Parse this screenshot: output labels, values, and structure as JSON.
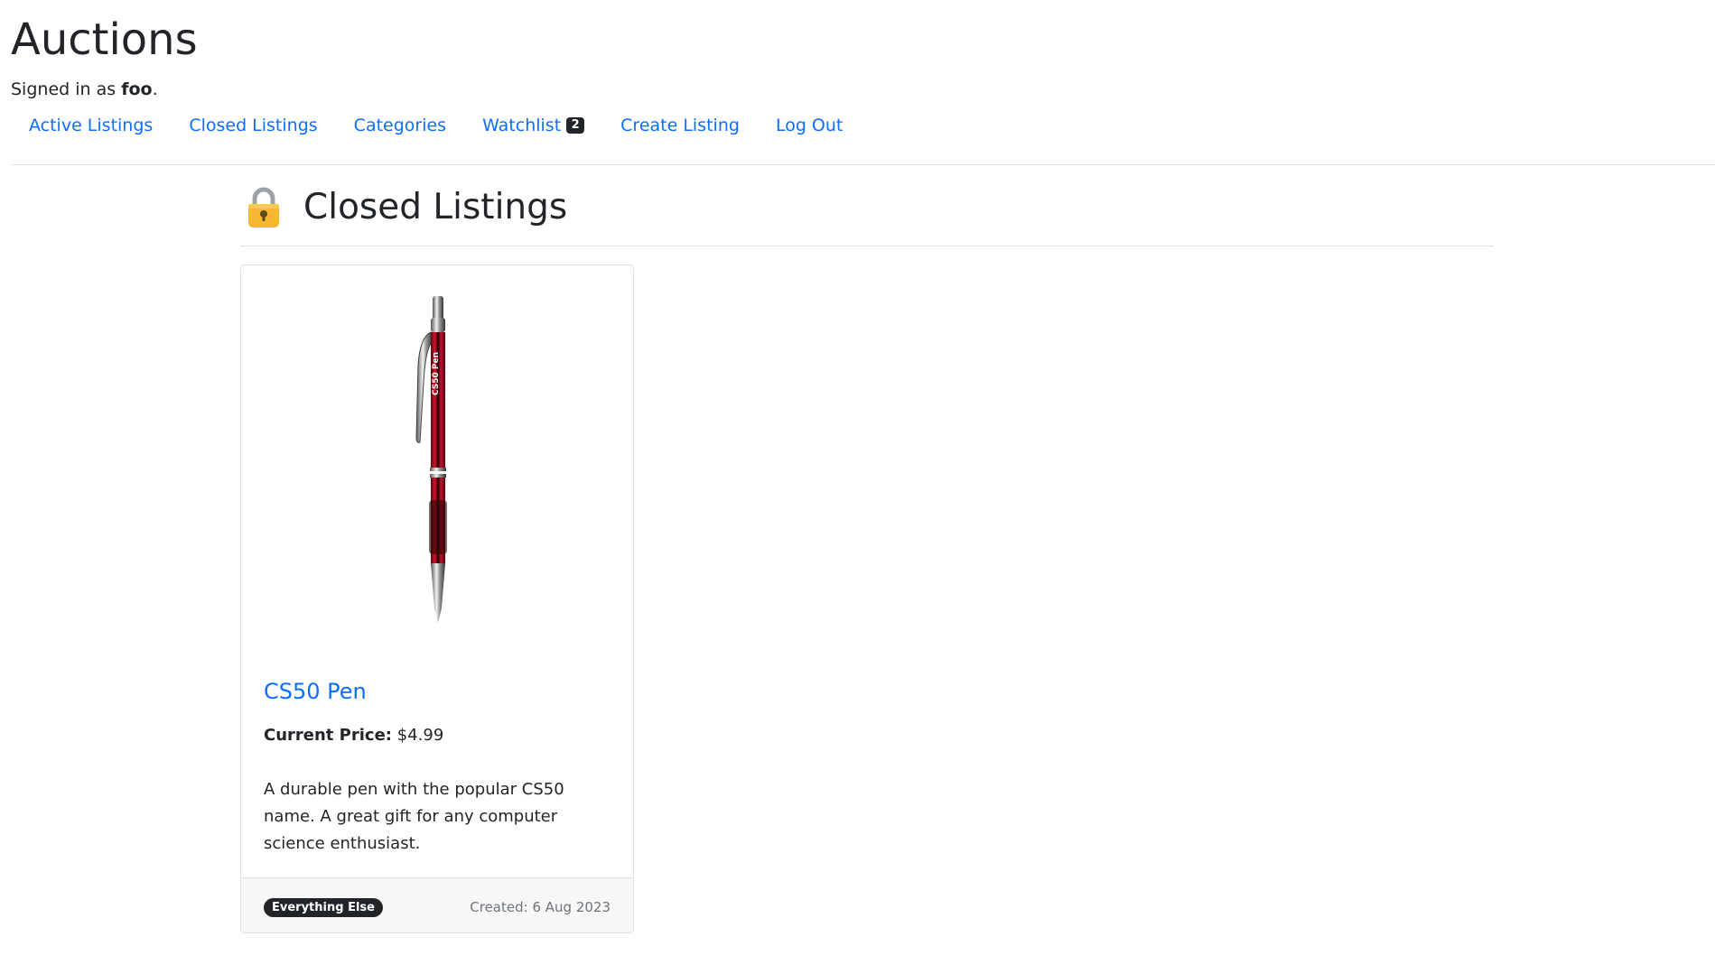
{
  "site": {
    "title": "Auctions",
    "signed_in_prefix": "Signed in as ",
    "username": "foo",
    "signed_in_suffix": "."
  },
  "nav": {
    "active_listings": "Active Listings",
    "closed_listings": "Closed Listings",
    "categories": "Categories",
    "watchlist": "Watchlist",
    "watchlist_count": "2",
    "create_listing": "Create Listing",
    "log_out": "Log Out"
  },
  "page": {
    "heading": "Closed Listings",
    "heading_icon": "lock-icon"
  },
  "listings": [
    {
      "image_icon": "pen-image",
      "image_text": "CS50 Pen",
      "title": "CS50 Pen",
      "price_label": "Current Price:",
      "price": "$4.99",
      "description": "A durable pen with the popular CS50 name. A great gift for any computer science enthusiast.",
      "category": "Everything Else",
      "created": "Created: 6 Aug 2023"
    }
  ],
  "colors": {
    "link": "#0d6efd",
    "text": "#212529",
    "muted": "#6c757d",
    "lock_body": "#f5b82e",
    "pen_body": "#c8102e"
  }
}
